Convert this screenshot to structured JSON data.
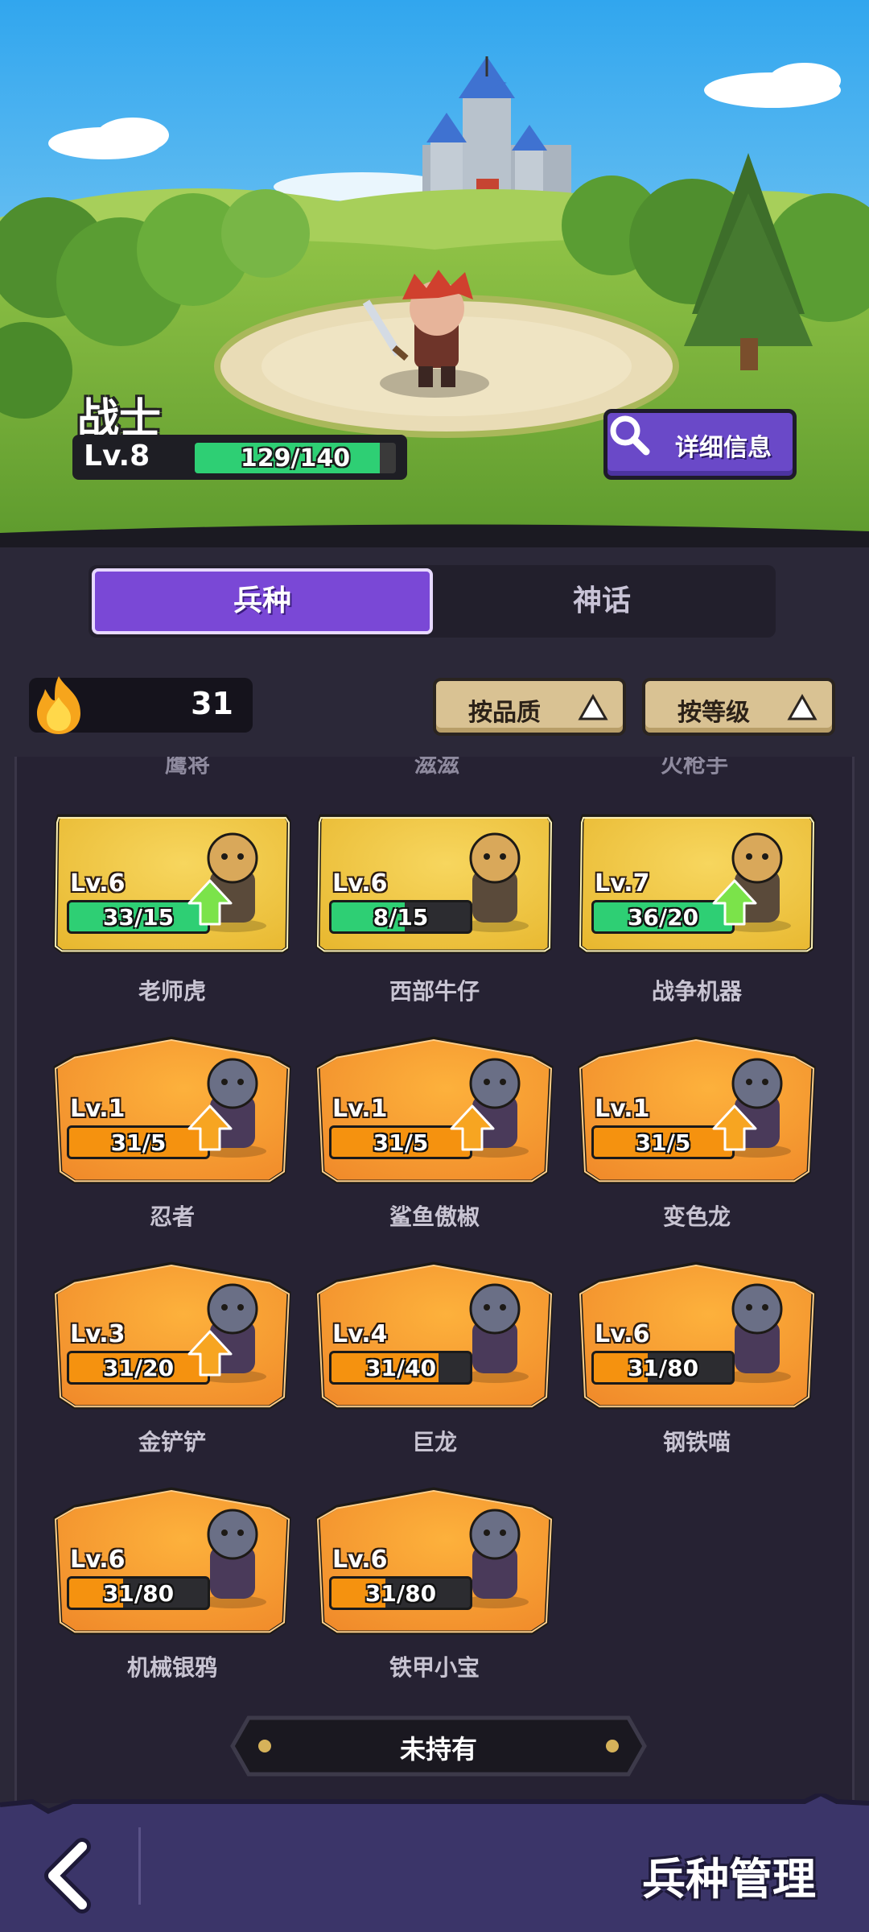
{
  "hero": {
    "name": "战士",
    "level_label": "Lv.8",
    "xp_text": "129/140",
    "xp_fraction": 0.921,
    "detail_button_label": "详细信息"
  },
  "tabs": [
    {
      "label": "兵种",
      "active": true
    },
    {
      "label": "神话",
      "active": false
    }
  ],
  "resource": {
    "value": "31"
  },
  "sort_buttons": [
    {
      "label": "按品质"
    },
    {
      "label": "按等级"
    }
  ],
  "top_partial_names": [
    "鹰将",
    "滋滋",
    "火枪手"
  ],
  "units": [
    {
      "name": "老师虎",
      "level": "Lv.6",
      "progress_text": "33/15",
      "progress": 1.0,
      "rarity": "gold",
      "upgradeable": true,
      "arrow": "green",
      "portrait": "tiger-icon"
    },
    {
      "name": "西部牛仔",
      "level": "Lv.6",
      "progress_text": "8/15",
      "progress": 0.53,
      "rarity": "gold",
      "upgradeable": false,
      "arrow": "",
      "portrait": "cowboy-icon"
    },
    {
      "name": "战争机器",
      "level": "Lv.7",
      "progress_text": "36/20",
      "progress": 1.0,
      "rarity": "gold",
      "upgradeable": true,
      "arrow": "green",
      "portrait": "war-machine-icon"
    },
    {
      "name": "忍者",
      "level": "Lv.1",
      "progress_text": "31/5",
      "progress": 1.0,
      "rarity": "orange",
      "upgradeable": true,
      "arrow": "orange",
      "portrait": "ninja-icon"
    },
    {
      "name": "鲨鱼傲椒",
      "level": "Lv.1",
      "progress_text": "31/5",
      "progress": 1.0,
      "rarity": "orange",
      "upgradeable": true,
      "arrow": "orange",
      "portrait": "shark-icon"
    },
    {
      "name": "变色龙",
      "level": "Lv.1",
      "progress_text": "31/5",
      "progress": 1.0,
      "rarity": "orange",
      "upgradeable": true,
      "arrow": "orange",
      "portrait": "chameleon-icon"
    },
    {
      "name": "金铲铲",
      "level": "Lv.3",
      "progress_text": "31/20",
      "progress": 1.0,
      "rarity": "orange",
      "upgradeable": true,
      "arrow": "orange",
      "portrait": "gold-digger-icon"
    },
    {
      "name": "巨龙",
      "level": "Lv.4",
      "progress_text": "31/40",
      "progress": 0.775,
      "rarity": "orange",
      "upgradeable": false,
      "arrow": "",
      "portrait": "dragon-icon"
    },
    {
      "name": "钢铁喵",
      "level": "Lv.6",
      "progress_text": "31/80",
      "progress": 0.3875,
      "rarity": "orange",
      "upgradeable": false,
      "arrow": "",
      "portrait": "iron-cat-icon"
    },
    {
      "name": "机械银鸦",
      "level": "Lv.6",
      "progress_text": "31/80",
      "progress": 0.3875,
      "rarity": "orange",
      "upgradeable": false,
      "arrow": "",
      "portrait": "plague-crow-icon"
    },
    {
      "name": "铁甲小宝",
      "level": "Lv.6",
      "progress_text": "31/80",
      "progress": 0.3875,
      "rarity": "orange",
      "upgradeable": false,
      "arrow": "",
      "portrait": "iron-baby-icon"
    }
  ],
  "not_owned_label": "未持有",
  "bottom_bar": {
    "title": "兵种管理",
    "back_icon": "chevron-left-icon"
  },
  "colors": {
    "gold_card": "#e8b830",
    "orange_card": "#f08a2a",
    "progress_green": "#2ecf74",
    "progress_orange": "#f5920f",
    "tab_active": "#7a48d6",
    "nav_bar": "#3b3569"
  }
}
